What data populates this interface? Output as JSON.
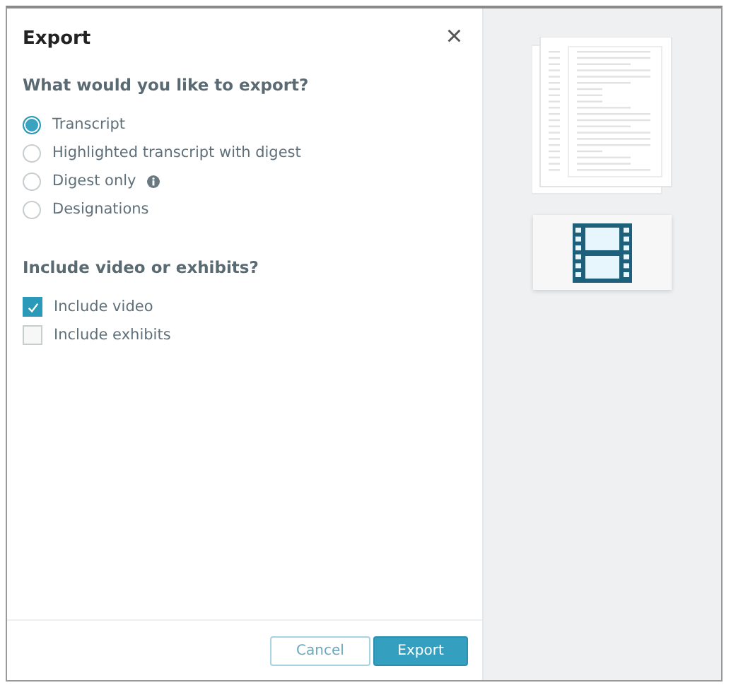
{
  "dialog": {
    "title": "Export",
    "close": "×"
  },
  "export_section": {
    "heading": "What would you like to export?",
    "options": [
      {
        "label": "Transcript",
        "selected": true,
        "info": false
      },
      {
        "label": "Highlighted transcript with digest",
        "selected": false,
        "info": false
      },
      {
        "label": "Digest only",
        "selected": false,
        "info": true
      },
      {
        "label": "Designations",
        "selected": false,
        "info": false
      }
    ]
  },
  "include_section": {
    "heading": "Include video or exhibits?",
    "options": [
      {
        "label": "Include video",
        "checked": true
      },
      {
        "label": "Include exhibits",
        "checked": false
      }
    ]
  },
  "buttons": [
    {
      "label": "Cancel",
      "kind": "secondary"
    },
    {
      "label": "Export",
      "kind": "primary"
    }
  ]
}
